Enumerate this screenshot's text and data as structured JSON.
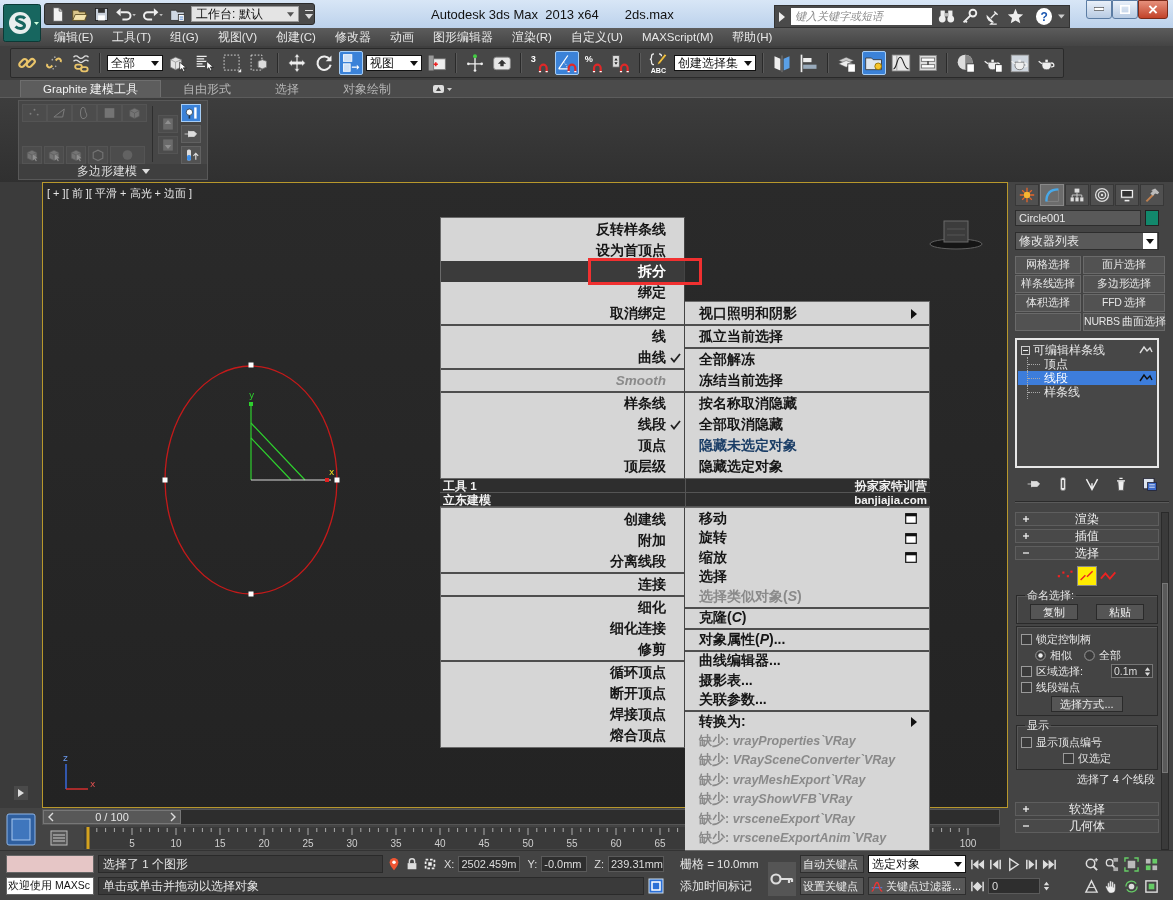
{
  "window": {
    "title": "Autodesk 3ds Max  2013 x64",
    "file": "2ds.max",
    "search_placeholder": "键入关键字或短语",
    "help": "?"
  },
  "quick_access": [
    {
      "kind": "new"
    },
    {
      "kind": "open"
    },
    {
      "kind": "save"
    },
    {
      "kind": "undo"
    },
    {
      "kind": "redo"
    },
    {
      "kind": "project"
    },
    {
      "kind": "dropdown",
      "value": "工作台: 默认"
    }
  ],
  "menu_bar": [
    "编辑(E)",
    "工具(T)",
    "组(G)",
    "视图(V)",
    "创建(C)",
    "修改器",
    "动画",
    "图形编辑器",
    "渲染(R)",
    "自定义(U)",
    "MAXScript(M)",
    "帮助(H)"
  ],
  "main_toolbar": [
    {
      "kind": "link",
      "active": false
    },
    {
      "kind": "unlink",
      "active": false
    },
    {
      "kind": "bind",
      "active": false
    },
    {
      "kind": "separator"
    },
    {
      "kind": "dropdown",
      "value": "全部"
    },
    {
      "kind": "select",
      "active": false
    },
    {
      "kind": "byname",
      "active": false
    },
    {
      "kind": "region",
      "active": false
    },
    {
      "kind": "crossing",
      "active": false
    },
    {
      "kind": "separator"
    },
    {
      "kind": "move",
      "active": false
    },
    {
      "kind": "rotate",
      "active": false
    },
    {
      "kind": "scale",
      "active": true
    },
    {
      "kind": "dropdown",
      "value": "视图"
    },
    {
      "kind": "pivot",
      "active": false
    },
    {
      "kind": "separator"
    },
    {
      "kind": "manipulate",
      "active": false
    },
    {
      "kind": "override",
      "active": false
    },
    {
      "kind": "separator"
    },
    {
      "kind": "snap",
      "label": "3",
      "active": false
    },
    {
      "kind": "anglesnap",
      "active": true
    },
    {
      "kind": "percentsnap",
      "label": "%",
      "active": false
    },
    {
      "kind": "spinnersnap",
      "active": false
    },
    {
      "kind": "separator"
    },
    {
      "kind": "namedsets",
      "label": "ABC",
      "active": false
    },
    {
      "kind": "dropdown",
      "value": "创建选择集"
    },
    {
      "kind": "separator"
    },
    {
      "kind": "mirror",
      "active": false
    },
    {
      "kind": "align",
      "active": false
    },
    {
      "kind": "separator"
    },
    {
      "kind": "layers",
      "active": false
    },
    {
      "kind": "explorer",
      "active": true
    },
    {
      "kind": "curveeditor",
      "active": false
    },
    {
      "kind": "schematic",
      "active": false
    },
    {
      "kind": "separator"
    },
    {
      "kind": "material",
      "active": false
    },
    {
      "kind": "rendersetup",
      "active": false
    },
    {
      "kind": "framewindow",
      "active": false
    },
    {
      "kind": "render",
      "active": false
    }
  ],
  "ribbon": {
    "tabs": [
      {
        "label": "Graphite 建模工具",
        "selected": true
      },
      {
        "label": "自由形式",
        "selected": false
      },
      {
        "label": "选择",
        "selected": false
      },
      {
        "label": "对象绘制",
        "selected": false
      }
    ],
    "panel_title": "多边形建模",
    "subobject_tools": [
      {
        "kind": "rvertex",
        "disabled": true,
        "active": false
      },
      {
        "kind": "redge",
        "disabled": true,
        "active": false
      },
      {
        "kind": "rborder",
        "disabled": true,
        "active": false
      },
      {
        "kind": "rpoly",
        "disabled": true,
        "active": false
      },
      {
        "kind": "relement",
        "disabled": true,
        "active": false
      }
    ],
    "action_tools": [
      {
        "kind": "rpick",
        "disabled": true,
        "active": false
      },
      {
        "kind": "rpick",
        "disabled": true,
        "active": false
      },
      {
        "kind": "rpick",
        "disabled": true,
        "active": false
      },
      {
        "kind": "rcage",
        "disabled": true,
        "active": false
      },
      {
        "kind": "rround",
        "disabled": true,
        "active": false
      }
    ],
    "side_tools": [
      {
        "kind": "rup",
        "disabled": true,
        "active": false
      },
      {
        "kind": "rdown",
        "disabled": true,
        "active": false
      }
    ],
    "panel_tools": [
      {
        "kind": "rbulb",
        "disabled": false,
        "active": true
      },
      {
        "kind": "rpin",
        "disabled": false,
        "active": false
      },
      {
        "kind": "rtube",
        "disabled": false,
        "active": false
      }
    ]
  },
  "viewport": {
    "label": "[ + ][ 前 ][ 平滑 + 高光 + 边面 ]",
    "active": true,
    "gizmo_labels": [
      "y",
      "x"
    ],
    "axis_labels": [
      "z",
      "x"
    ]
  },
  "quad_menu": {
    "quadrants": [
      {
        "kind": "upper-left",
        "label": "工具 1",
        "groups": [
          [
            {
              "label": "反转样条线",
              "kind": "command",
              "checked": false,
              "disabled": false,
              "selected": false,
              "last_used": false
            },
            {
              "label": "设为首顶点",
              "kind": "command",
              "checked": false,
              "disabled": false,
              "selected": false,
              "last_used": false
            },
            {
              "label": "拆分",
              "kind": "command",
              "checked": false,
              "disabled": false,
              "selected": true,
              "last_used": false
            },
            {
              "label": "绑定",
              "kind": "command",
              "checked": false,
              "disabled": false,
              "selected": false,
              "last_used": false
            },
            {
              "label": "取消绑定",
              "kind": "command",
              "checked": false,
              "disabled": false,
              "selected": false,
              "last_used": false
            }
          ],
          [
            {
              "label": "线",
              "kind": "command",
              "checked": false,
              "disabled": false,
              "selected": false,
              "last_used": false
            },
            {
              "label": "曲线",
              "kind": "command",
              "checked": true,
              "disabled": false,
              "selected": false,
              "last_used": false
            }
          ],
          [
            {
              "label": "Smooth",
              "kind": "caption",
              "checked": false,
              "disabled": true,
              "selected": false,
              "last_used": false
            }
          ],
          [
            {
              "label": "样条线",
              "kind": "command",
              "checked": false,
              "disabled": false,
              "selected": false,
              "last_used": false
            },
            {
              "label": "线段",
              "kind": "command",
              "checked": true,
              "disabled": false,
              "selected": false,
              "last_used": false
            },
            {
              "label": "顶点",
              "kind": "command",
              "checked": false,
              "disabled": false,
              "selected": false,
              "last_used": false
            },
            {
              "label": "顶层级",
              "kind": "command",
              "checked": false,
              "disabled": false,
              "selected": false,
              "last_used": false
            }
          ]
        ]
      },
      {
        "kind": "upper-right",
        "label": "扮家家特训营",
        "groups": [
          [
            {
              "label": "视口照明和阴影",
              "kind": "submenu",
              "checked": false,
              "disabled": false,
              "selected": false,
              "last_used": false
            }
          ],
          [
            {
              "label": "孤立当前选择",
              "kind": "command",
              "checked": false,
              "disabled": false,
              "selected": false,
              "last_used": false
            }
          ],
          [
            {
              "label": "全部解冻",
              "kind": "command",
              "checked": false,
              "disabled": false,
              "selected": false,
              "last_used": false
            },
            {
              "label": "冻结当前选择",
              "kind": "command",
              "checked": false,
              "disabled": false,
              "selected": false,
              "last_used": false
            }
          ],
          [
            {
              "label": "按名称取消隐藏",
              "kind": "command",
              "checked": false,
              "disabled": false,
              "selected": false,
              "last_used": false
            },
            {
              "label": "全部取消隐藏",
              "kind": "command",
              "checked": false,
              "disabled": false,
              "selected": false,
              "last_used": false
            },
            {
              "label": "隐藏未选定对象",
              "kind": "command",
              "checked": false,
              "disabled": false,
              "selected": false,
              "last_used": true
            },
            {
              "label": "隐藏选定对象",
              "kind": "command",
              "checked": false,
              "disabled": false,
              "selected": false,
              "last_used": false
            }
          ]
        ]
      },
      {
        "kind": "lower-left",
        "label": "立东建模",
        "groups": [
          [
            {
              "label": "创建线",
              "kind": "command",
              "checked": false,
              "disabled": false,
              "selected": false,
              "last_used": false
            },
            {
              "label": "附加",
              "kind": "command",
              "checked": false,
              "disabled": false,
              "selected": false,
              "last_used": false
            },
            {
              "label": "分离线段",
              "kind": "command",
              "checked": false,
              "disabled": false,
              "selected": false,
              "last_used": false
            }
          ],
          [
            {
              "label": "连接",
              "kind": "command",
              "checked": false,
              "disabled": false,
              "selected": false,
              "last_used": false
            }
          ],
          [
            {
              "label": "细化",
              "kind": "command",
              "checked": false,
              "disabled": false,
              "selected": false,
              "last_used": false
            },
            {
              "label": "细化连接",
              "kind": "command",
              "checked": false,
              "disabled": false,
              "selected": false,
              "last_used": false
            },
            {
              "label": "修剪",
              "kind": "command",
              "checked": false,
              "disabled": false,
              "selected": false,
              "last_used": false
            }
          ],
          [
            {
              "label": "循环顶点",
              "kind": "command",
              "checked": false,
              "disabled": false,
              "selected": false,
              "last_used": false
            },
            {
              "label": "断开顶点",
              "kind": "command",
              "checked": false,
              "disabled": false,
              "selected": false,
              "last_used": false
            },
            {
              "label": "焊接顶点",
              "kind": "command",
              "checked": false,
              "disabled": false,
              "selected": false,
              "last_used": false
            },
            {
              "label": "熔合顶点",
              "kind": "command",
              "checked": false,
              "disabled": false,
              "selected": false,
              "last_used": false
            }
          ]
        ]
      },
      {
        "kind": "lower-right",
        "label": "banjiajia.com",
        "groups": [
          [
            {
              "label": "移动",
              "kind": "dialog",
              "checked": false,
              "disabled": false,
              "selected": false,
              "last_used": false
            },
            {
              "label": "旋转",
              "kind": "dialog",
              "checked": false,
              "disabled": false,
              "selected": false,
              "last_used": false
            },
            {
              "label": "缩放",
              "kind": "dialog",
              "checked": false,
              "disabled": false,
              "selected": false,
              "last_used": false
            },
            {
              "label": "选择",
              "kind": "command",
              "checked": false,
              "disabled": false,
              "selected": false,
              "last_used": false
            },
            {
              "label": "选择类似对象(*S*)",
              "kind": "command",
              "checked": false,
              "disabled": true,
              "selected": false,
              "last_used": false
            }
          ],
          [
            {
              "label": "克隆(*C*)",
              "kind": "command",
              "checked": false,
              "disabled": false,
              "selected": false,
              "last_used": false
            }
          ],
          [
            {
              "label": "对象属性(*P*)...",
              "kind": "command",
              "checked": false,
              "disabled": false,
              "selected": false,
              "last_used": false
            }
          ],
          [
            {
              "label": "曲线编辑器...",
              "kind": "command",
              "checked": false,
              "disabled": false,
              "selected": false,
              "last_used": false
            },
            {
              "label": "摄影表...",
              "kind": "command",
              "checked": false,
              "disabled": false,
              "selected": false,
              "last_used": false
            },
            {
              "label": "关联参数...",
              "kind": "command",
              "checked": false,
              "disabled": false,
              "selected": false,
              "last_used": false
            }
          ],
          [
            {
              "label": "转换为:",
              "kind": "submenu",
              "checked": false,
              "disabled": false,
              "selected": false,
              "last_used": false
            },
            {
              "label": "缺少: *vrayProperties`VRay*",
              "kind": "missing",
              "checked": false,
              "disabled": true,
              "selected": false,
              "last_used": false
            },
            {
              "label": "缺少: *VRaySceneConverter`VRay*",
              "kind": "missing",
              "checked": false,
              "disabled": true,
              "selected": false,
              "last_used": false
            },
            {
              "label": "缺少: *vrayMeshExport`VRay*",
              "kind": "missing",
              "checked": false,
              "disabled": true,
              "selected": false,
              "last_used": false
            },
            {
              "label": "缺少: *vrayShowVFB`VRay*",
              "kind": "missing",
              "checked": false,
              "disabled": true,
              "selected": false,
              "last_used": false
            },
            {
              "label": "缺少: *vrsceneExport`VRay*",
              "kind": "missing",
              "checked": false,
              "disabled": true,
              "selected": false,
              "last_used": false
            },
            {
              "label": "缺少: *vrsceneExportAnim`VRay*",
              "kind": "missing",
              "checked": false,
              "disabled": true,
              "selected": false,
              "last_used": false
            }
          ]
        ]
      }
    ]
  },
  "command_panel": {
    "tabs": [
      {
        "kind": "create",
        "selected": false
      },
      {
        "kind": "modify",
        "selected": true
      },
      {
        "kind": "hierarchy",
        "selected": false
      },
      {
        "kind": "motion",
        "selected": false
      },
      {
        "kind": "display",
        "selected": false
      },
      {
        "kind": "utilities",
        "selected": false
      }
    ],
    "object_name": "Circle001",
    "modifier_list": "修改器列表",
    "modifier_buttons": [
      {
        "kind": "button",
        "label": "网格选择"
      },
      {
        "kind": "button",
        "label": "面片选择"
      },
      {
        "kind": "button",
        "label": "样条线选择"
      },
      {
        "kind": "button",
        "label": "多边形选择"
      },
      {
        "kind": "button",
        "label": "体积选择"
      },
      {
        "kind": "button",
        "label": "FFD 选择"
      },
      {
        "kind": "blank"
      },
      {
        "kind": "button",
        "label": "NURBS 曲面选择"
      }
    ],
    "stack": [
      {
        "label": "可编辑样条线",
        "expanded": true,
        "selected": false,
        "marked": true,
        "children": [
          {
            "label": "顶点",
            "selected": false,
            "marked": false
          },
          {
            "label": "线段",
            "selected": true,
            "marked": true
          },
          {
            "label": "样条线",
            "selected": false,
            "marked": false
          }
        ]
      }
    ],
    "rollouts": [
      {
        "kind": "plain",
        "title": "渲染",
        "expanded": false
      },
      {
        "kind": "plain",
        "title": "插值",
        "expanded": false
      },
      {
        "kind": "selection",
        "title": "选择",
        "expanded": true,
        "content": {
          "levels": [
            {
              "kind": "vertex",
              "selected": false
            },
            {
              "kind": "segment",
              "selected": true
            },
            {
              "kind": "spline",
              "selected": false
            }
          ],
          "named_selection": {
            "title": "命名选择:",
            "buttons": [
              "复制",
              "粘贴"
            ]
          },
          "lock_handles": {
            "label": "锁定控制柄",
            "checked": false
          },
          "handle_modes": [
            {
              "label": "相似",
              "selected": true
            },
            {
              "label": "全部",
              "selected": false
            }
          ],
          "area_selection": {
            "label": "区域选择:",
            "checked": false,
            "value": "0.1m"
          },
          "segment_end": {
            "label": "线段端点",
            "checked": false
          },
          "select_by": "选择方式...",
          "display": {
            "title": "显示",
            "options": [
              {
                "label": "显示顶点编号",
                "checked": false
              },
              {
                "label": "仅选定",
                "checked": false
              }
            ]
          },
          "status": "选择了 4 个线段"
        }
      },
      {
        "kind": "plain",
        "title": "软选择",
        "expanded": false
      },
      {
        "kind": "plain",
        "title": "几何体",
        "expanded": true
      }
    ]
  },
  "time_slider": {
    "label": "0 / 100",
    "level": 0
  },
  "track_bar": {
    "labels": [
      "5",
      "10",
      "15",
      "20",
      "25",
      "30",
      "35",
      "40",
      "45",
      "50",
      "55",
      "60",
      "65"
    ],
    "end_label": "100"
  },
  "status_bar": {
    "listener_output": "欢迎使用 MAXSc",
    "selection_info": "选择了 1 个图形",
    "prompt": "单击或单击并拖动以选择对象",
    "coordinates": [
      {
        "axis": "X:",
        "value": "2502.459m"
      },
      {
        "axis": "Y:",
        "value": "-0.0mm"
      },
      {
        "axis": "Z:",
        "value": "239.31mm"
      }
    ],
    "grid": "栅格 = 10.0mm",
    "add_time_tag": "添加时间标记",
    "auto_key": "自动关键点",
    "set_key": "设置关键点",
    "key_set": "选定对象",
    "key_filters": "关键点过滤器...",
    "frame": "0"
  }
}
